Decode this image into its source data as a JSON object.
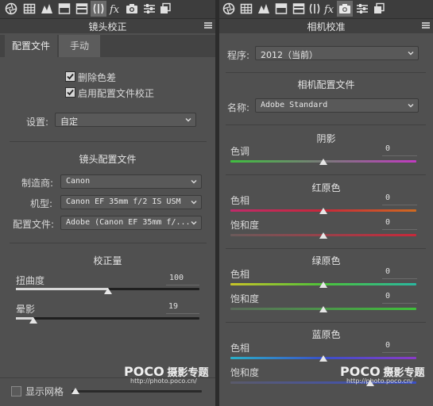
{
  "toolbar": {
    "icons": [
      "aperture-icon",
      "grid-icon",
      "mountain-icon",
      "detail-icon",
      "split-icon",
      "lens-icon",
      "fx-icon",
      "camera-icon",
      "sliders-icon",
      "presets-icon"
    ]
  },
  "left": {
    "panel_title": "镜头校正",
    "tabs": [
      "配置文件",
      "手动"
    ],
    "check_remove_ca": "删除色差",
    "check_enable_profile": "启用配置文件校正",
    "setup_label": "设置:",
    "setup_value": "自定",
    "lens_profile_heading": "镜头配置文件",
    "make_label": "制造商:",
    "make_value": "Canon",
    "model_label": "机型:",
    "model_value": "Canon EF 35mm f/2 IS USM",
    "profile_label": "配置文件:",
    "profile_value": "Adobe (Canon EF 35mm f/...",
    "amount_heading": "校正量",
    "distortion_label": "扭曲度",
    "distortion_value": "100",
    "distortion_fraction": 0.5,
    "vignetting_label": "晕影",
    "vignetting_value": "19",
    "vignetting_fraction": 0.095,
    "show_grid_label": "显示网格",
    "grid_fraction": 0.0
  },
  "right": {
    "panel_title": "相机校准",
    "process_label": "程序:",
    "process_value": "2012（当前）",
    "camera_profile_heading": "相机配置文件",
    "name_label": "名称:",
    "name_value": "Adobe Standard",
    "shadows_heading": "阴影",
    "shadows_tint_label": "色调",
    "shadows_tint_value": "0",
    "red_heading": "红原色",
    "red_hue_label": "色相",
    "red_hue_value": "0",
    "red_sat_label": "饱和度",
    "red_sat_value": "0",
    "green_heading": "绿原色",
    "green_hue_label": "色相",
    "green_hue_value": "0",
    "green_sat_label": "饱和度",
    "green_sat_value": "0",
    "blue_heading": "蓝原色",
    "blue_hue_label": "色相",
    "blue_hue_value": "0",
    "blue_sat_label": "饱和度",
    "blue_sat_value": "0"
  },
  "watermark": {
    "brand": "POCO",
    "brand_cn": "摄影专题",
    "url": "http://photo.poco.cn/"
  },
  "colors": {
    "panel_bg": "#505050",
    "toolbar_bg": "#3d3d3d",
    "text": "#dcdcdc"
  }
}
